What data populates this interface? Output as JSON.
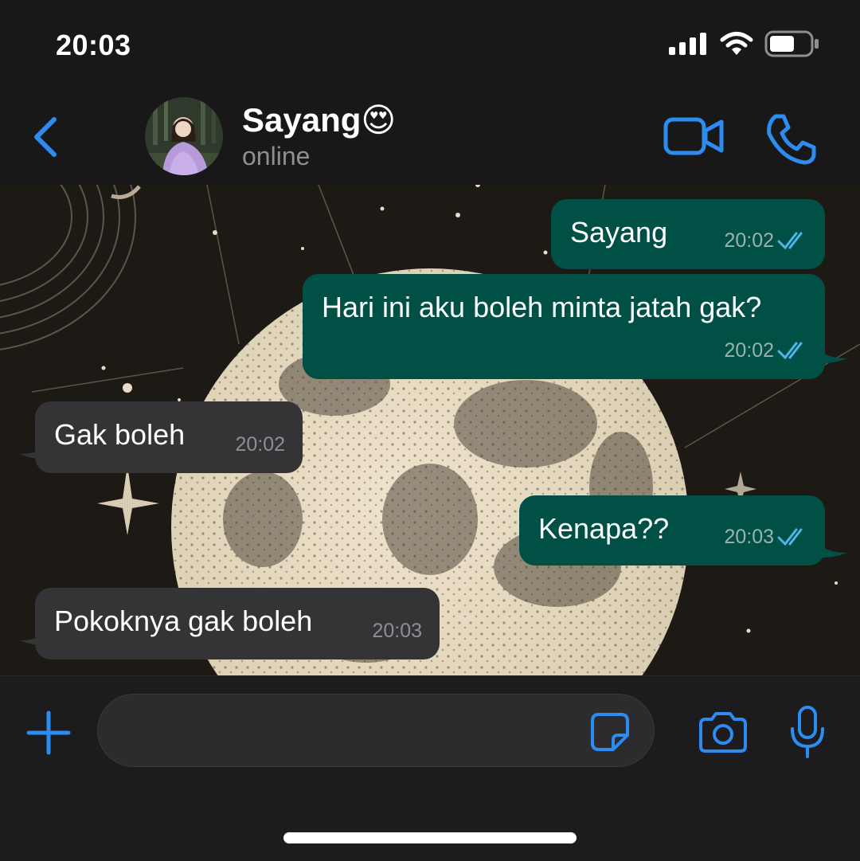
{
  "status_bar": {
    "time": "20:03"
  },
  "header": {
    "contact_name": "Sayang😍",
    "contact_status": "online"
  },
  "messages": [
    {
      "direction": "outgoing",
      "text": "Sayang",
      "time": "20:02",
      "status": "read"
    },
    {
      "direction": "outgoing",
      "text": "Hari ini aku boleh minta jatah gak?",
      "time": "20:02",
      "status": "read"
    },
    {
      "direction": "incoming",
      "text": "Gak boleh",
      "time": "20:02"
    },
    {
      "direction": "outgoing",
      "text": "Kenapa??",
      "time": "20:03",
      "status": "read"
    },
    {
      "direction": "incoming",
      "text": "Pokoknya gak boleh",
      "time": "20:03"
    }
  ],
  "input": {
    "value": "",
    "placeholder": ""
  },
  "icons": {
    "back": "chevron-left-icon",
    "video_call": "video-camera-icon",
    "voice_call": "phone-icon",
    "attach": "plus-icon",
    "sticker": "sticker-icon",
    "camera": "camera-icon",
    "microphone": "microphone-icon",
    "read_receipt": "double-check-icon"
  },
  "colors": {
    "accent": "#2d8cf0",
    "outgoing_bubble": "#005046",
    "incoming_bubble": "#343436",
    "background": "#181818",
    "read_check": "#4fb6ec"
  }
}
